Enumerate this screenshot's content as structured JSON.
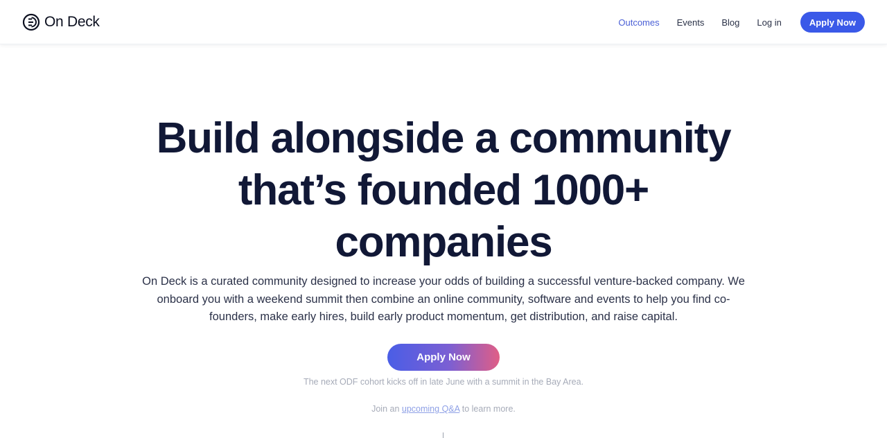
{
  "brand": {
    "name": "On Deck",
    "logo_icon": "on-deck-logo-icon",
    "color": "#0b0f1f"
  },
  "nav": {
    "links": [
      {
        "label": "Outcomes",
        "active": true
      },
      {
        "label": "Events",
        "active": false
      },
      {
        "label": "Blog",
        "active": false
      },
      {
        "label": "Log in",
        "active": false
      }
    ],
    "cta_label": "Apply Now",
    "active_color": "#4a5fd6",
    "cta_color": "#3a59e8"
  },
  "hero": {
    "headline_line1": "Build alongside a community",
    "headline_line2": "that’s founded 1000+",
    "headline_line3": "companies",
    "description": "On Deck is a curated community designed to increase your odds of building a successful venture-backed company. We onboard you with a weekend summit then combine an online community, software and events to help you find co-founders, make early hires, build early product momentum, get distribution, and raise capital.",
    "cta_label": "Apply Now",
    "cta_gradient": [
      "#4a5ee6",
      "#7b5fd3",
      "#e05e86"
    ],
    "cohort_note": "The next ODF cohort kicks off in late June with a summit in the Bay Area.",
    "qa_prefix": "Join an ",
    "qa_link": "upcoming Q&A",
    "qa_suffix": " to learn more."
  }
}
